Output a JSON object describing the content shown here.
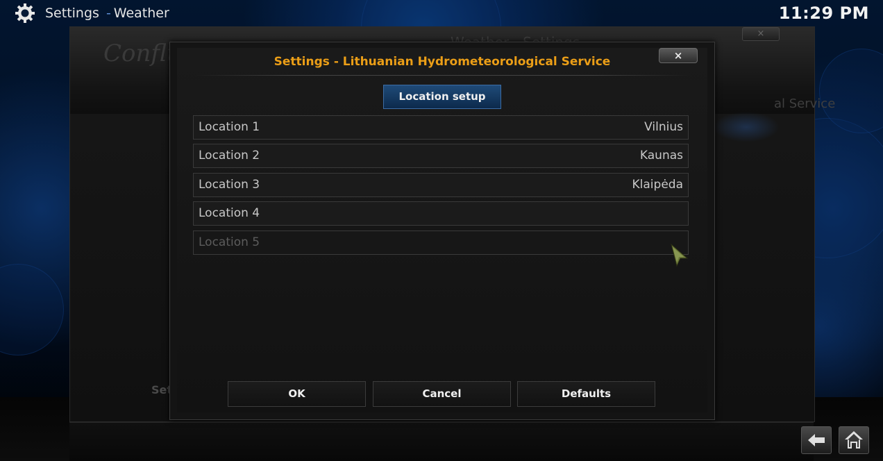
{
  "topbar": {
    "title": "Settings",
    "separator": "-",
    "section": "Weather",
    "clock": "11:29 PM",
    "icon": "gear-icon"
  },
  "background_window": {
    "title": "Weather - Settings",
    "logo": "Confluence",
    "close_label": "×",
    "provider_fragment": "al Service",
    "footer_fragment": "Set"
  },
  "dialog": {
    "title": "Settings - Lithuanian Hydrometeorological Service",
    "close_label": "×",
    "category": "Location setup",
    "locations": [
      {
        "label": "Location 1",
        "value": "Vilnius",
        "enabled": true
      },
      {
        "label": "Location 2",
        "value": "Kaunas",
        "enabled": true
      },
      {
        "label": "Location 3",
        "value": "Klaipėda",
        "enabled": true
      },
      {
        "label": "Location 4",
        "value": "",
        "enabled": true
      },
      {
        "label": "Location 5",
        "value": "",
        "enabled": false
      }
    ],
    "buttons": {
      "ok": "OK",
      "cancel": "Cancel",
      "defaults": "Defaults"
    },
    "title_color": "#eb9e17",
    "accent_color": "#1f4a78"
  },
  "nav": {
    "back_icon": "back-arrow-icon",
    "home_icon": "home-icon"
  }
}
